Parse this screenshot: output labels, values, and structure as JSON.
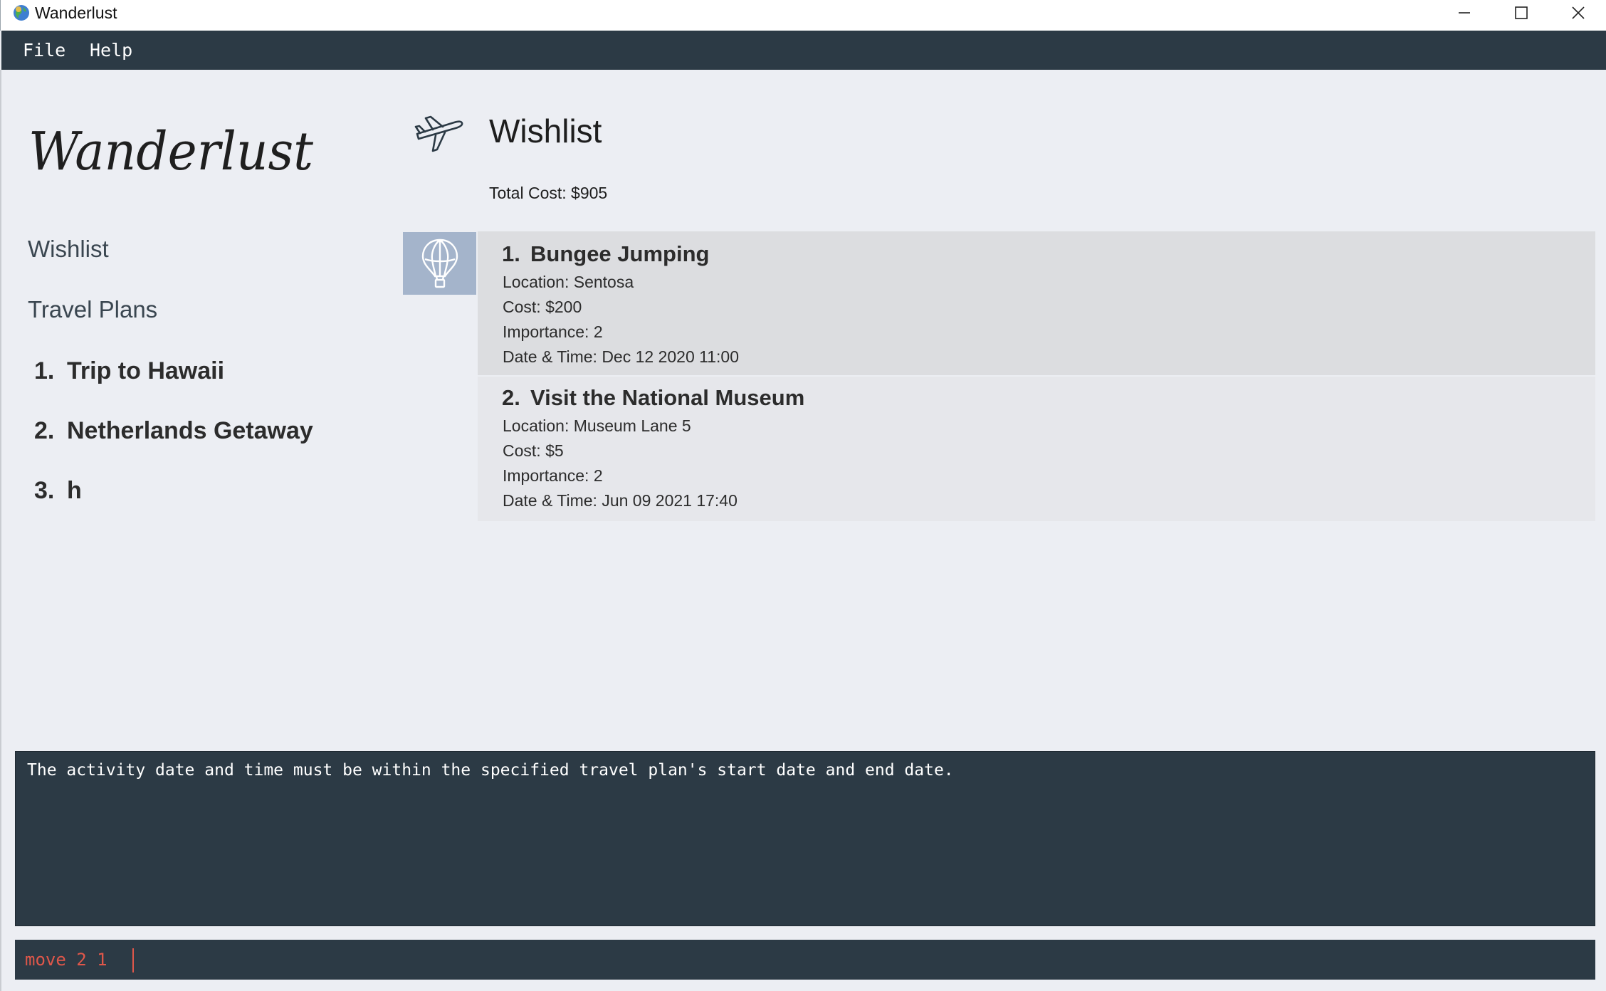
{
  "window": {
    "title": "Wanderlust",
    "icon": "globe-icon",
    "controls": [
      "minimize-icon",
      "maximize-icon",
      "close-icon"
    ]
  },
  "menu": {
    "items": [
      {
        "label": "File"
      },
      {
        "label": "Help"
      }
    ]
  },
  "sidebar": {
    "logo_text": "Wanderlust",
    "wishlist_label": "Wishlist",
    "travel_plans_label": "Travel Plans",
    "plans": [
      {
        "number": "1.",
        "name": "Trip to Hawaii"
      },
      {
        "number": "2.",
        "name": "Netherlands Getaway"
      },
      {
        "number": "3.",
        "name": "h"
      }
    ]
  },
  "main": {
    "icon": "airplane-icon",
    "title": "Wishlist",
    "total_cost": "Total Cost: $905",
    "activities": [
      {
        "number": "1.",
        "name": "Bungee Jumping",
        "location": "Location: Sentosa",
        "cost": "Cost: $200",
        "importance": "Importance: 2",
        "datetime": "Date & Time: Dec 12 2020 11:00",
        "selected": true,
        "icon": "hot-air-balloon-icon"
      },
      {
        "number": "2.",
        "name": "Visit the National Museum",
        "location": "Location: Museum Lane 5",
        "cost": "Cost: $5",
        "importance": "Importance: 2",
        "datetime": "Date & Time: Jun 09 2021 17:40",
        "selected": false
      }
    ]
  },
  "result_display": {
    "text": "The activity date and time must be within the specified travel plan's start date and end date."
  },
  "command_box": {
    "value": "move 2 1"
  },
  "colors": {
    "background": "#eceef3",
    "dark_panel": "#2c3a45",
    "command_text": "#e0574a",
    "selected_card": "#dcdde0",
    "icon_box": "#a4b4cb"
  }
}
